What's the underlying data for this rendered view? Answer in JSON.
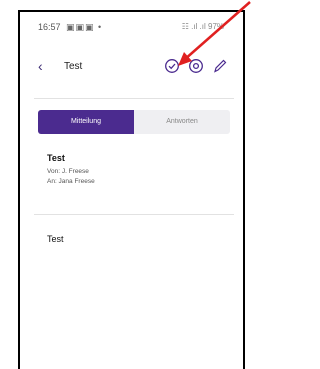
{
  "status_bar": {
    "time": "16:57",
    "notifications": "▣▣▣ •",
    "signal": "☷ .ıl .ıl 97%"
  },
  "header": {
    "title": "Test",
    "back_icon": "chevron-left-icon",
    "actions": [
      "check-circle-icon",
      "eye-icon",
      "pencil-icon"
    ]
  },
  "tabs": [
    {
      "label": "Mitteilung",
      "active": true
    },
    {
      "label": "Antworten",
      "active": false
    }
  ],
  "message": {
    "subject": "Test",
    "from": "Von: J. Freese",
    "to": "An: Jana Freese",
    "body": "Test"
  },
  "colors": {
    "accent": "#4b2b8f",
    "annotation_arrow": "#e02020"
  }
}
